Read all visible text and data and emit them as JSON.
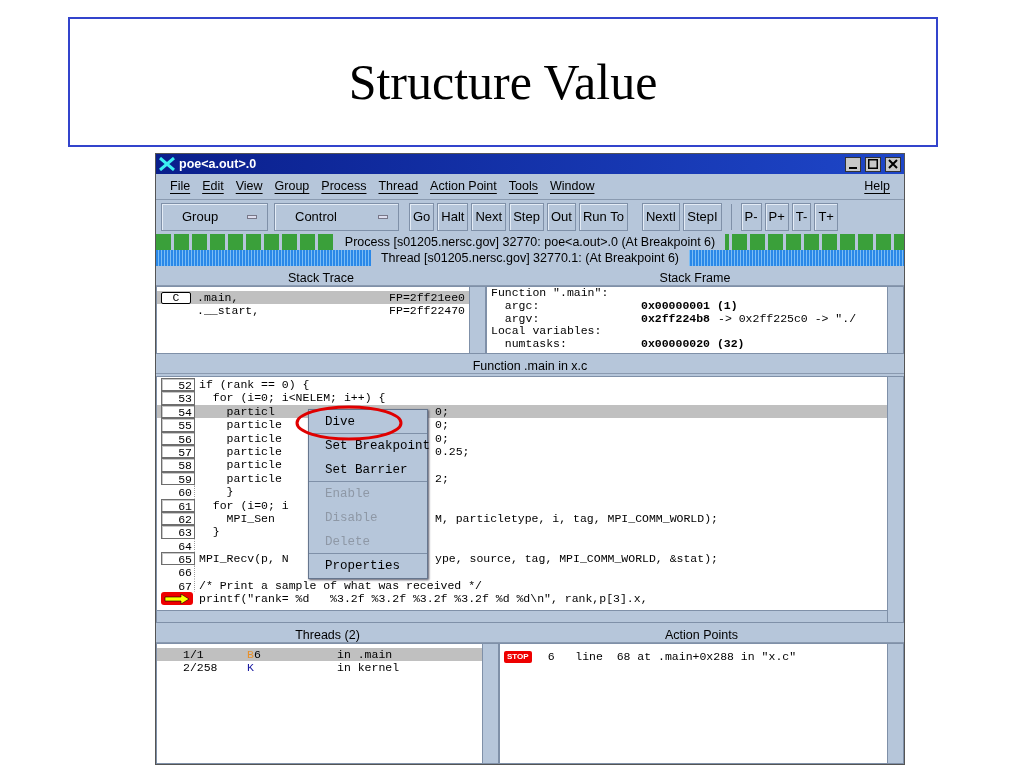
{
  "slide_title": "Structure Value",
  "window": {
    "title": "poe<a.out>.0"
  },
  "menu_bar": [
    {
      "label": "File"
    },
    {
      "label": "Edit"
    },
    {
      "label": "View"
    },
    {
      "label": "Group"
    },
    {
      "label": "Process"
    },
    {
      "label": "Thread"
    },
    {
      "label": "Action Point"
    },
    {
      "label": "Tools"
    },
    {
      "label": "Window"
    },
    {
      "label": "Help",
      "kind": "right"
    }
  ],
  "toolbar": {
    "dropdowns": [
      "Group",
      "Control"
    ],
    "button_groups": [
      [
        "Go",
        "Halt",
        "Next",
        "Step",
        "Out",
        "Run To"
      ],
      [
        "NextI",
        "StepI"
      ],
      [
        "P-",
        "P+",
        "T-",
        "T+"
      ]
    ]
  },
  "process_status": "Process [s01205.nersc.gov] 32770: poe<a.out>.0 (At Breakpoint 6)",
  "thread_status": "Thread [s01205.nersc.gov] 32770.1:  (At Breakpoint 6)",
  "stack_trace": {
    "title": "Stack Trace",
    "frames": [
      {
        "lang": "C",
        "name": ".main,",
        "fp": "FP=2ff21ee0",
        "selected": true
      },
      {
        "name": ".__start,",
        "fp": "FP=2ff22470",
        "selected": false
      }
    ]
  },
  "stack_frame": {
    "title": "Stack Frame",
    "lines": [
      {
        "kind": "heading",
        "text": "Function \".main\":"
      },
      {
        "kind": "var",
        "label": "argc:",
        "value": "0x00000001 (1)"
      },
      {
        "kind": "var",
        "label": "argv:",
        "value": "0x2ff224b8",
        "rest": "-> 0x2ff225c0 -> \"./"
      },
      {
        "kind": "heading",
        "text": "Local variables:"
      },
      {
        "kind": "var",
        "label": "numtasks:",
        "value": "0x00000020 (32)"
      }
    ]
  },
  "source": {
    "title": "Function .main in x.c",
    "lines": [
      {
        "number": "52",
        "boxed": true,
        "selected": false,
        "text": "if (rank == 0) {"
      },
      {
        "number": "53",
        "boxed": true,
        "selected": false,
        "text": "  for (i=0; i<NELEM; i++) {"
      },
      {
        "number": "54",
        "boxed": true,
        "selected": true,
        "text": "    particl",
        "after": "0;"
      },
      {
        "number": "55",
        "boxed": true,
        "selected": false,
        "text": "    particle",
        "after": "0;"
      },
      {
        "number": "56",
        "boxed": true,
        "selected": false,
        "text": "    particle",
        "after": "0;"
      },
      {
        "number": "57",
        "boxed": true,
        "selected": false,
        "text": "    particle",
        "after": "0.25;"
      },
      {
        "number": "58",
        "boxed": true,
        "selected": false,
        "text": "    particle"
      },
      {
        "number": "59",
        "boxed": true,
        "selected": false,
        "text": "    particle",
        "after": "2;"
      },
      {
        "number": "60",
        "boxed": false,
        "selected": false,
        "text": "    }"
      },
      {
        "number": "61",
        "boxed": true,
        "selected": false,
        "text": "  for (i=0; i"
      },
      {
        "number": "62",
        "boxed": true,
        "selected": false,
        "text": "    MPI_Sen",
        "after": "M, particletype, i, tag, MPI_COMM_WORLD);"
      },
      {
        "number": "63",
        "boxed": true,
        "selected": false,
        "text": "  }"
      },
      {
        "number": "64",
        "boxed": false,
        "selected": false
      },
      {
        "number": "65",
        "boxed": true,
        "selected": false,
        "text": "MPI_Recv(p, N",
        "after": "ype, source, tag, MPI_COMM_WORLD, &stat);"
      },
      {
        "number": "66",
        "boxed": false,
        "selected": false
      },
      {
        "number": "67",
        "boxed": false,
        "selected": false,
        "text": "/* Print a sample of what was received */"
      },
      {
        "kind": "pc",
        "selected": false,
        "text": "printf(\"rank= %d   %3.2f %3.2f %3.2f %3.2f %d %d\\n\", rank,p[3].x,"
      }
    ]
  },
  "context_menu": [
    {
      "label": "Dive",
      "disabled": false,
      "circled": true,
      "separator_after": true
    },
    {
      "label": "Set Breakpoint",
      "disabled": false,
      "circled": false,
      "separator_after": false
    },
    {
      "label": "Set Barrier",
      "disabled": false,
      "circled": false,
      "separator_after": true
    },
    {
      "label": "Enable",
      "disabled": true,
      "circled": false,
      "separator_after": false
    },
    {
      "label": "Disable",
      "disabled": true,
      "circled": false,
      "separator_after": false
    },
    {
      "label": "Delete",
      "disabled": true,
      "circled": false,
      "separator_after": true
    },
    {
      "label": "Properties",
      "disabled": false,
      "circled": false,
      "separator_after": false
    }
  ],
  "threads": {
    "title": "Threads (2)",
    "rows": [
      {
        "id": "1/1",
        "status": "B",
        "status_rest": "6",
        "color": "#e8902a",
        "location": "in .main",
        "selected": true
      },
      {
        "id": "2/258",
        "status": "K",
        "color": "#1a1aa0",
        "location": "in kernel",
        "selected": false
      }
    ]
  },
  "action_points": {
    "title": "Action Points",
    "items": [
      {
        "badge": "STOP",
        "text": "6   line  68 at .main+0x288 in \"x.c\""
      }
    ]
  }
}
